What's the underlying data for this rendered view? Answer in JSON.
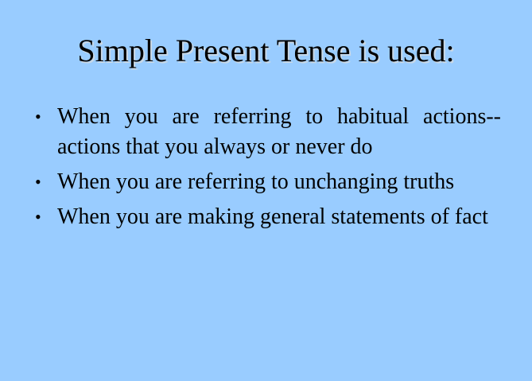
{
  "slide": {
    "title": "Simple Present Tense is used:",
    "bullets": [
      {
        "text": "When you are referring to habitual actions--actions that you always or never do"
      },
      {
        "text": "When you are referring to unchanging truths"
      },
      {
        "text": "When you are making general statements of fact"
      }
    ],
    "colors": {
      "background": "#99ccff",
      "text": "#000000"
    }
  }
}
